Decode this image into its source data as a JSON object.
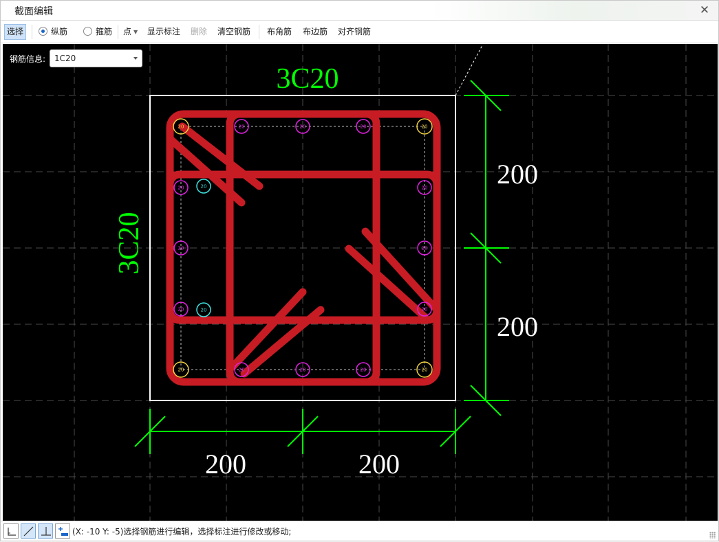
{
  "window": {
    "title": "截面编辑",
    "close_glyph": "✕"
  },
  "toolbar": {
    "select": "选择",
    "longitudinal": "纵筋",
    "stirrup": "箍筋",
    "point": "点",
    "show_labels": "显示标注",
    "delete": "删除",
    "clear_rebar": "清空钢筋",
    "corner_rebar": "布角筋",
    "edge_rebar": "布边筋",
    "align_rebar": "对齐钢筋"
  },
  "rebar_info": {
    "label": "钢筋信息:",
    "value": "1C20"
  },
  "drawing": {
    "top_label": "3C20",
    "side_label": "3C20",
    "dim_right_upper": "200",
    "dim_right_lower": "200",
    "dim_bottom_left": "200",
    "dim_bottom_right": "200",
    "bar_size_label": "20",
    "colors": {
      "background": "#000000",
      "section_outline": "#ffffff",
      "stirrup": "#c81c25",
      "dimension": "#00ff00",
      "corner_bar": "#f0d040",
      "edge_bar": "#e020e0",
      "selected_bar": "#40e0e0",
      "grid": "#4a4a4a",
      "dim_text": "#ffffff",
      "label_text": "#00ff00"
    }
  },
  "statusbar": {
    "message": "(X: -10 Y: -5)选择钢筋进行编辑，选择标注进行修改或移动;",
    "buttons": [
      "ortho-mode-icon",
      "line-snap-icon",
      "perpendicular-icon",
      "add-bar-icon"
    ]
  }
}
